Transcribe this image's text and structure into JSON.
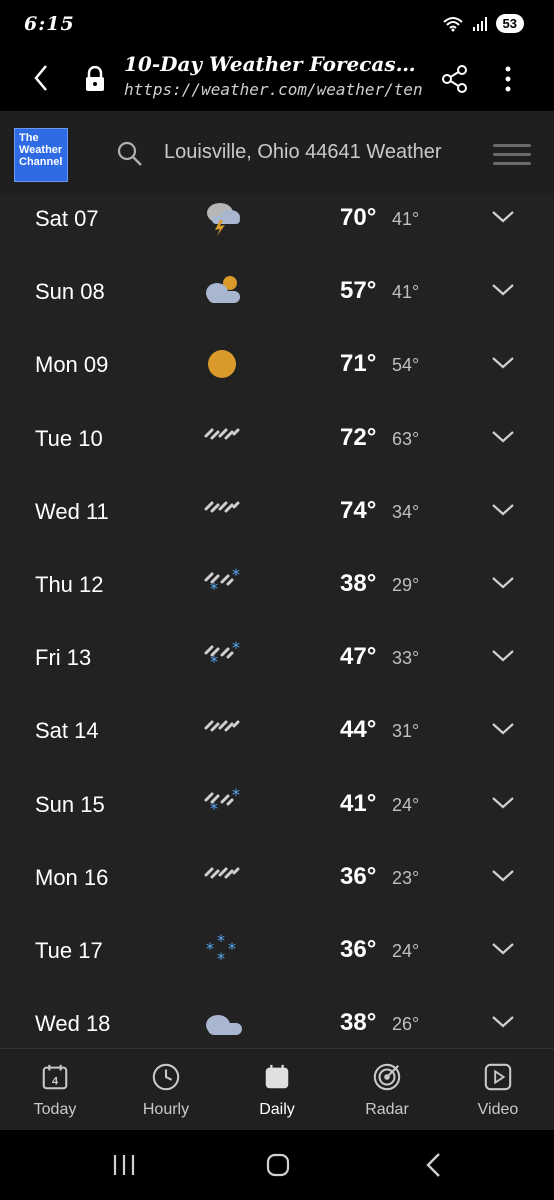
{
  "status": {
    "time": "6:15",
    "battery": "53",
    "net": "6"
  },
  "browser": {
    "title": "10-Day Weather Forecast...",
    "url": "https://weather.com/weather/ten"
  },
  "site": {
    "logo_lines": [
      "The",
      "Weather",
      "Channel"
    ],
    "search_text": "Louisville, Ohio 44641 Weather"
  },
  "forecast": [
    {
      "day": "Sat 07",
      "icon": "thunderstorm-icon",
      "hi": "70°",
      "lo": "41°"
    },
    {
      "day": "Sun 08",
      "icon": "partly-cloudy-icon",
      "hi": "57°",
      "lo": "41°"
    },
    {
      "day": "Mon 09",
      "icon": "sunny-icon",
      "hi": "71°",
      "lo": "54°"
    },
    {
      "day": "Tue 10",
      "icon": "rain-icon",
      "hi": "72°",
      "lo": "63°"
    },
    {
      "day": "Wed 11",
      "icon": "rain-icon",
      "hi": "74°",
      "lo": "34°"
    },
    {
      "day": "Thu 12",
      "icon": "rain-snow-icon",
      "hi": "38°",
      "lo": "29°"
    },
    {
      "day": "Fri 13",
      "icon": "rain-snow-icon",
      "hi": "47°",
      "lo": "33°"
    },
    {
      "day": "Sat 14",
      "icon": "rain-icon",
      "hi": "44°",
      "lo": "31°"
    },
    {
      "day": "Sun 15",
      "icon": "rain-snow-icon",
      "hi": "41°",
      "lo": "24°"
    },
    {
      "day": "Mon 16",
      "icon": "rain-icon",
      "hi": "36°",
      "lo": "23°"
    },
    {
      "day": "Tue 17",
      "icon": "snow-icon",
      "hi": "36°",
      "lo": "24°"
    },
    {
      "day": "Wed 18",
      "icon": "cloudy-icon",
      "hi": "38°",
      "lo": "26°"
    }
  ],
  "bottom_nav": [
    {
      "label": "Today",
      "icon": "calendar-icon",
      "badge": "4",
      "active": false
    },
    {
      "label": "Hourly",
      "icon": "clock-icon",
      "active": false
    },
    {
      "label": "Daily",
      "icon": "calendar-filled-icon",
      "active": true
    },
    {
      "label": "Radar",
      "icon": "radar-icon",
      "active": false
    },
    {
      "label": "Video",
      "icon": "video-icon",
      "active": false
    }
  ],
  "colors": {
    "background": "#222223",
    "sun": "#d99a2b",
    "snow": "#5aa9f5",
    "logo": "#2e6be5"
  }
}
